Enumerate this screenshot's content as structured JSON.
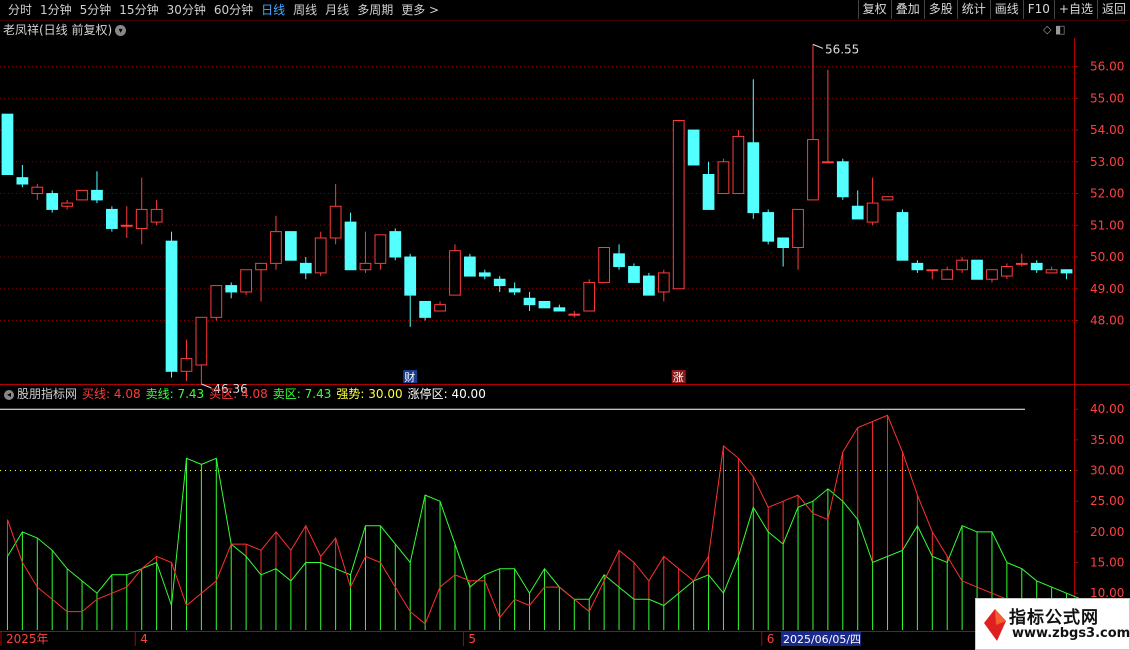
{
  "toolbar": {
    "periods": [
      "分时",
      "1分钟",
      "5分钟",
      "15分钟",
      "30分钟",
      "60分钟",
      "日线",
      "周线",
      "月线",
      "多周期",
      "更多 >"
    ],
    "active_index": 6,
    "right_buttons": [
      "复权",
      "叠加",
      "多股",
      "统计",
      "画线",
      "F10",
      "+自选",
      "返回"
    ]
  },
  "chart_title": "老凤祥(日线 前复权)",
  "indicator_header": {
    "name": "股朋指标网",
    "items": [
      {
        "label": "买线:",
        "value": "4.08",
        "color": "#ff3c3c"
      },
      {
        "label": "卖线:",
        "value": "7.43",
        "color": "#3cff3c"
      },
      {
        "label": "买区:",
        "value": "4.08",
        "color": "#ff3c3c"
      },
      {
        "label": "卖区:",
        "value": "7.43",
        "color": "#3cff3c"
      },
      {
        "label": "强势:",
        "value": "30.00",
        "color": "#ffff3c"
      },
      {
        "label": "涨停区:",
        "value": "40.00",
        "color": "#ffffff"
      }
    ]
  },
  "colors": {
    "up": "#ff3c3c",
    "down": "#54ffff",
    "grid": "#8c0000",
    "buy_line": "#ff3030",
    "sell_line": "#33ff33"
  },
  "chart_data": [
    {
      "type": "candlestick",
      "y_ticks": [
        "56.00",
        "55.00",
        "54.00",
        "53.00",
        "52.00",
        "51.00",
        "50.00",
        "49.00",
        "48.00"
      ],
      "ylim": [
        46.0,
        56.9
      ],
      "high_label": "56.55",
      "low_label": "46.36",
      "markers": [
        "财",
        "涨"
      ],
      "x_labels": [
        "2025年",
        "4",
        "5",
        "6"
      ],
      "cursor_date": "2025/06/05/四",
      "ohlc": [
        [
          54.5,
          54.5,
          52.6,
          52.6
        ],
        [
          52.5,
          52.9,
          52.2,
          52.3
        ],
        [
          52.0,
          52.3,
          51.8,
          52.2
        ],
        [
          52.0,
          52.1,
          51.4,
          51.5
        ],
        [
          51.6,
          51.8,
          51.5,
          51.7
        ],
        [
          51.8,
          52.1,
          51.8,
          52.1
        ],
        [
          52.1,
          52.7,
          51.7,
          51.8
        ],
        [
          51.5,
          51.6,
          50.8,
          50.9
        ],
        [
          51.0,
          51.6,
          50.6,
          51.0
        ],
        [
          50.9,
          52.5,
          50.4,
          51.5
        ],
        [
          51.1,
          51.8,
          51.0,
          51.5
        ],
        [
          50.5,
          50.8,
          46.2,
          46.4
        ],
        [
          46.4,
          47.4,
          46.1,
          46.8
        ],
        [
          46.6,
          48.1,
          46.0,
          48.1
        ],
        [
          48.1,
          49.1,
          48.0,
          49.1
        ],
        [
          49.1,
          49.2,
          48.7,
          48.9
        ],
        [
          48.9,
          49.6,
          48.8,
          49.6
        ],
        [
          49.6,
          49.8,
          48.6,
          49.8
        ],
        [
          49.8,
          51.3,
          49.6,
          50.8
        ],
        [
          50.8,
          50.8,
          49.9,
          49.9
        ],
        [
          49.8,
          50.0,
          49.3,
          49.5
        ],
        [
          49.5,
          50.8,
          49.4,
          50.6
        ],
        [
          50.6,
          52.3,
          50.4,
          51.6
        ],
        [
          51.1,
          51.4,
          49.6,
          49.6
        ],
        [
          49.6,
          50.8,
          49.5,
          49.8
        ],
        [
          49.8,
          50.7,
          49.6,
          50.7
        ],
        [
          50.8,
          50.9,
          49.9,
          50.0
        ],
        [
          50.0,
          50.1,
          47.8,
          48.8
        ],
        [
          48.6,
          48.6,
          48.0,
          48.1
        ],
        [
          48.3,
          48.6,
          48.3,
          48.5
        ],
        [
          48.8,
          50.4,
          48.8,
          50.2
        ],
        [
          50.0,
          50.1,
          49.4,
          49.4
        ],
        [
          49.5,
          49.6,
          49.3,
          49.4
        ],
        [
          49.3,
          49.4,
          48.9,
          49.1
        ],
        [
          49.0,
          49.2,
          48.8,
          48.9
        ],
        [
          48.7,
          48.9,
          48.3,
          48.5
        ],
        [
          48.6,
          48.6,
          48.4,
          48.4
        ],
        [
          48.4,
          48.5,
          48.3,
          48.3
        ],
        [
          48.2,
          48.3,
          48.1,
          48.2
        ],
        [
          48.3,
          49.3,
          48.3,
          49.2
        ],
        [
          49.2,
          50.3,
          49.2,
          50.3
        ],
        [
          50.1,
          50.4,
          49.6,
          49.7
        ],
        [
          49.7,
          49.8,
          49.2,
          49.2
        ],
        [
          49.4,
          49.5,
          48.8,
          48.8
        ],
        [
          48.9,
          49.6,
          48.6,
          49.5
        ],
        [
          49.0,
          54.3,
          49.0,
          54.3
        ],
        [
          54.0,
          54.0,
          52.9,
          52.9
        ],
        [
          52.6,
          53.0,
          51.5,
          51.5
        ],
        [
          52.0,
          53.1,
          52.0,
          53.0
        ],
        [
          52.0,
          54.0,
          52.0,
          53.8
        ],
        [
          53.6,
          55.6,
          51.2,
          51.4
        ],
        [
          51.4,
          51.5,
          50.4,
          50.5
        ],
        [
          50.6,
          50.6,
          49.7,
          50.3
        ],
        [
          50.3,
          51.5,
          49.6,
          51.5
        ],
        [
          51.8,
          56.7,
          51.8,
          53.7
        ],
        [
          53.0,
          55.9,
          53.0,
          53.0
        ],
        [
          53.0,
          53.1,
          51.8,
          51.9
        ],
        [
          51.6,
          52.1,
          51.4,
          51.2
        ],
        [
          51.1,
          52.5,
          51.0,
          51.7
        ],
        [
          51.8,
          51.9,
          51.8,
          51.9
        ],
        [
          51.4,
          51.5,
          49.9,
          49.9
        ],
        [
          49.8,
          49.9,
          49.5,
          49.6
        ],
        [
          49.6,
          49.6,
          49.3,
          49.6
        ],
        [
          49.3,
          49.7,
          49.3,
          49.6
        ],
        [
          49.6,
          50.0,
          49.5,
          49.9
        ],
        [
          49.9,
          49.9,
          49.3,
          49.3
        ],
        [
          49.3,
          49.6,
          49.2,
          49.6
        ],
        [
          49.4,
          49.8,
          49.3,
          49.7
        ],
        [
          49.8,
          50.1,
          49.7,
          49.8
        ],
        [
          49.8,
          49.9,
          49.5,
          49.6
        ],
        [
          49.5,
          49.7,
          49.5,
          49.6
        ],
        [
          49.6,
          49.6,
          49.3,
          49.5
        ]
      ]
    },
    {
      "type": "line",
      "y_ticks": [
        "40.00",
        "35.00",
        "30.00",
        "25.00",
        "20.00",
        "15.00",
        "10.00"
      ],
      "ylim": [
        4.0,
        41.5
      ],
      "reference_lines": [
        {
          "name": "强势",
          "value": 30
        },
        {
          "name": "涨停区",
          "value": 40
        }
      ],
      "series": [
        {
          "name": "买线",
          "values": [
            22,
            15,
            11,
            9,
            7,
            7,
            9,
            10,
            11,
            14,
            16,
            15,
            8,
            10,
            12,
            18,
            18,
            17,
            20,
            17,
            21,
            16,
            19,
            11,
            16,
            15,
            11,
            7,
            5,
            11,
            13,
            12,
            12,
            6,
            9,
            8,
            11,
            11,
            9,
            7,
            12,
            17,
            15,
            12,
            16,
            14,
            12,
            16,
            34,
            32,
            29,
            24,
            25,
            26,
            23,
            22,
            33,
            37,
            38,
            39,
            33,
            26,
            20,
            16,
            12,
            11,
            10,
            9,
            9,
            8,
            8,
            7,
            6
          ]
        },
        {
          "name": "卖线",
          "values": [
            16,
            20,
            19,
            17,
            14,
            12,
            10,
            13,
            13,
            14,
            15,
            8,
            32,
            31,
            32,
            18,
            16,
            13,
            14,
            12,
            15,
            15,
            14,
            13,
            21,
            21,
            18,
            15,
            26,
            25,
            18,
            11,
            13,
            14,
            14,
            10,
            14,
            11,
            9,
            9,
            13,
            11,
            9,
            9,
            8,
            10,
            12,
            13,
            10,
            16,
            24,
            20,
            18,
            24,
            25,
            27,
            25,
            22,
            15,
            16,
            17,
            21,
            16,
            15,
            21,
            20,
            20,
            15,
            14,
            12,
            11,
            10,
            9,
            7
          ]
        }
      ]
    }
  ],
  "watermark": {
    "line1": "指标公式网",
    "line2": "www.zbgs3.com"
  }
}
